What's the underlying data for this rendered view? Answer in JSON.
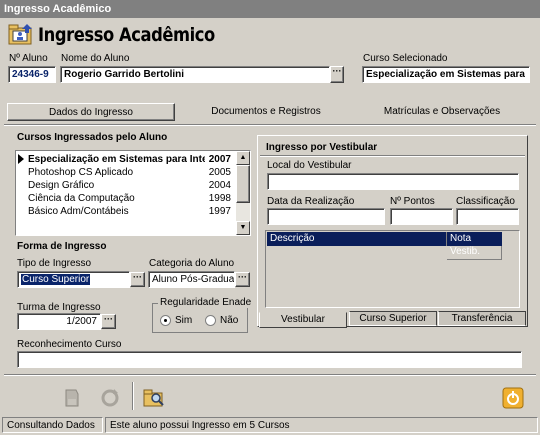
{
  "window": {
    "title": "Ingresso Acadêmico"
  },
  "header": {
    "title": "Ingresso Acadêmico",
    "icon": "app-folder-icon"
  },
  "aluno": {
    "numero_label": "Nº Aluno",
    "numero_value": "24346-9",
    "nome_label": "Nome do Aluno",
    "nome_value": "Rogerio Garrido Bertolini",
    "curso_label": "Curso Selecionado",
    "curso_value": "Especialização em Sistemas para"
  },
  "tabs": [
    {
      "label": "Dados do Ingresso",
      "active": true
    },
    {
      "label": "Documentos e Registros",
      "active": false
    },
    {
      "label": "Matrículas e Observações",
      "active": false
    }
  ],
  "cursos": {
    "title": "Cursos Ingressados pelo Aluno",
    "rows": [
      {
        "nome": "Especialização em Sistemas para Inte",
        "ano": "2007",
        "selected": true
      },
      {
        "nome": "Photoshop CS Aplicado",
        "ano": "2005",
        "selected": false
      },
      {
        "nome": "Design Gráfico",
        "ano": "2004",
        "selected": false
      },
      {
        "nome": "Ciência da Computação",
        "ano": "1998",
        "selected": false
      },
      {
        "nome": "Básico Adm/Contábeis",
        "ano": "1997",
        "selected": false
      }
    ]
  },
  "forma": {
    "title": "Forma de Ingresso",
    "tipo_label": "Tipo de Ingresso",
    "tipo_value": "Curso Superior",
    "categoria_label": "Categoria do Aluno",
    "categoria_value": "Aluno Pós-Graduação",
    "turma_label": "Turma de Ingresso",
    "turma_value": "1/2007",
    "regularidade_label": "Regularidade Enade",
    "sim_label": "Sim",
    "nao_label": "Não",
    "reconhecimento_label": "Reconhecimento Curso",
    "reconhecimento_value": ""
  },
  "vestibular": {
    "title": "Ingresso por Vestibular",
    "local_label": "Local do Vestibular",
    "local_value": "",
    "data_label": "Data da Realização",
    "pontos_label": "Nº Pontos",
    "classificacao_label": "Classificação",
    "grid_headers": [
      "Descrição",
      "Nota Vestib."
    ],
    "subtabs": [
      {
        "label": "Vestibular",
        "active": true
      },
      {
        "label": "Curso Superior",
        "active": false
      },
      {
        "label": "Transferência",
        "active": false
      }
    ]
  },
  "toolbar": {
    "icons": [
      "save-icon",
      "refresh-icon",
      "search-folder-icon",
      "exit-icon"
    ]
  },
  "status": {
    "left": "Consultando Dados",
    "right": "Este aluno possui Ingresso em 5 Cursos"
  },
  "colors": {
    "selection": "#0a246a",
    "grid_header": "#0a1e5a",
    "exit_icon": "#f0b030"
  }
}
